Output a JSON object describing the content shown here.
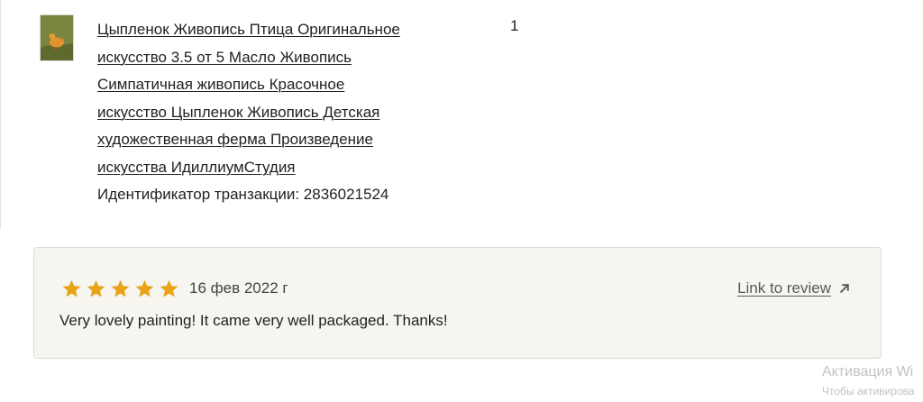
{
  "item": {
    "title_lines": [
      "Цыпленок Живопись Птица Оригинальное",
      "искусство 3.5 от 5 Масло Живопись",
      "Симпатичная живопись Красочное",
      "искусство Цыпленок Живопись Детская",
      "художественная ферма Произведение",
      "искусства ИдиллиумСтудия"
    ],
    "transaction": "Идентификатор транзакции: 2836021524",
    "quantity": "1"
  },
  "review": {
    "rating": 5,
    "rating_max": 5,
    "star_color": "#e8a317",
    "date": "16 фев 2022 г",
    "text": "Very lovely painting! It came very well packaged. Thanks!",
    "link_label": "Link to review",
    "link_icon": "arrow-up-right-icon"
  },
  "watermark": {
    "title": "Активация Wi",
    "subtitle": "Чтобы активирова"
  }
}
